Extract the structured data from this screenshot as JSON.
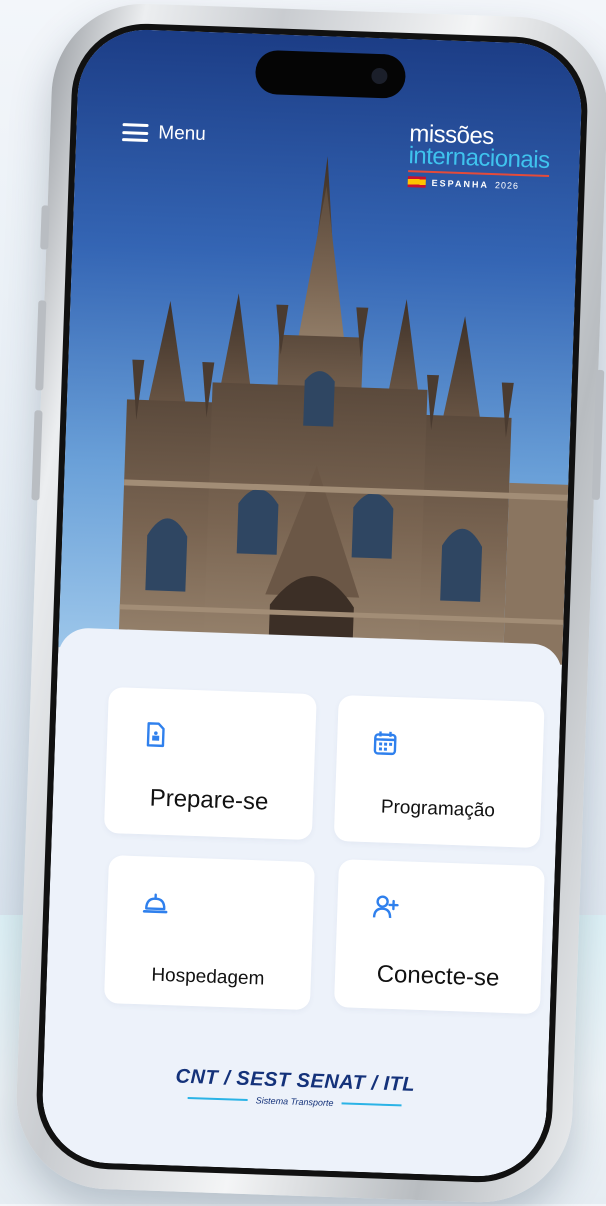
{
  "header": {
    "menu_label": "Menu",
    "brand": {
      "line1": "missões",
      "line2": "internacionais",
      "country": "ESPANHA",
      "year": "2026"
    }
  },
  "hero": {
    "image": "cathedral-photo"
  },
  "cards": [
    {
      "label": "Prepare-se",
      "icon": "document-icon"
    },
    {
      "label": "Programação",
      "icon": "calendar-icon"
    },
    {
      "label": "Hospedagem",
      "icon": "service-bell-icon"
    },
    {
      "label": "Conecte-se",
      "icon": "add-user-icon"
    }
  ],
  "footer": {
    "logo_text": "CNT / SEST SENAT / ITL",
    "tagline": "Sistema Transporte"
  },
  "colors": {
    "accent": "#2f80ed",
    "brand_cyan": "#3fc3ee",
    "footer_navy": "#14327a",
    "sheet_bg": "#edf2fa"
  }
}
